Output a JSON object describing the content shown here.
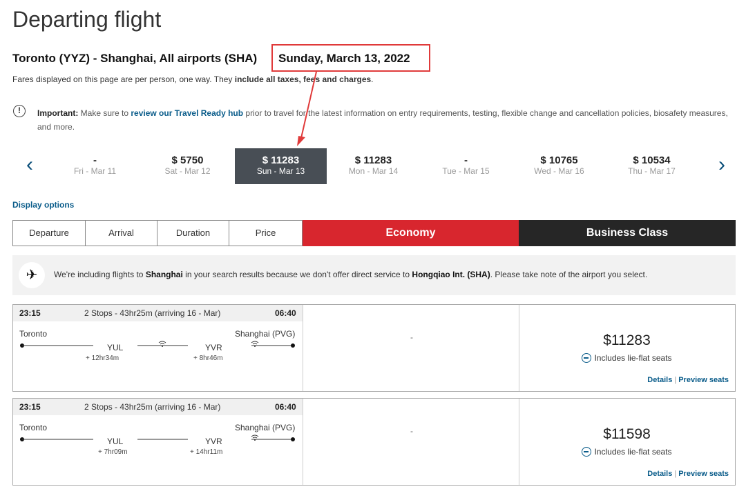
{
  "page_title": "Departing flight",
  "route": "Toronto (YYZ) - Shanghai, All airports (SHA)",
  "selected_date": "Sunday, March 13, 2022",
  "fares_note_prefix": "Fares displayed on this page are per person, one way. They ",
  "fares_note_bold": "include all taxes, fees and charges",
  "fares_note_suffix": ".",
  "important": {
    "label": "Important:",
    "text1": " Make sure to ",
    "link": "review our Travel Ready hub",
    "text2": " prior to travel for the latest information on entry requirements, testing, flexible change and cancellation policies, biosafety measures, and more."
  },
  "dates": [
    {
      "price": "-",
      "date": "Fri - Mar 11"
    },
    {
      "price": "$ 5750",
      "date": "Sat - Mar 12"
    },
    {
      "price": "$ 11283",
      "date": "Sun - Mar 13"
    },
    {
      "price": "$ 11283",
      "date": "Mon - Mar 14"
    },
    {
      "price": "-",
      "date": "Tue - Mar 15"
    },
    {
      "price": "$ 10765",
      "date": "Wed - Mar 16"
    },
    {
      "price": "$ 10534",
      "date": "Thu - Mar 17"
    }
  ],
  "display_options": "Display options",
  "sort": {
    "departure": "Departure",
    "arrival": "Arrival",
    "duration": "Duration",
    "price": "Price"
  },
  "cabins": {
    "economy": "Economy",
    "business": "Business Class"
  },
  "colors": {
    "economy": "#d8262e",
    "business": "#262626",
    "selected_date": "#484e55",
    "link": "#0a5c8a",
    "annotation": "#e03a3a"
  },
  "notice": {
    "t1": "We're including flights to ",
    "b1": "Shanghai",
    "t2": " in your search results because we don't offer direct service to ",
    "b2": "Hongqiao Int. (SHA)",
    "t3": ". Please take note of the airport you select."
  },
  "flights": [
    {
      "dep": "23:15",
      "stops": "2 Stops - 43hr25m (arriving 16 - Mar)",
      "arr": "06:40",
      "from": "Toronto",
      "to": "Shanghai (PVG)",
      "stop1": "YUL",
      "stop2": "YVR",
      "lay1": "+ 12hr34m",
      "lay2": "+ 8hr46m",
      "details": "Details",
      "preview": "Preview seats",
      "economy": "-",
      "price": "$11283",
      "seats": "Includes lie-flat seats"
    },
    {
      "dep": "23:15",
      "stops": "2 Stops - 43hr25m (arriving 16 - Mar)",
      "arr": "06:40",
      "from": "Toronto",
      "to": "Shanghai (PVG)",
      "stop1": "YUL",
      "stop2": "YVR",
      "lay1": "+ 7hr09m",
      "lay2": "+ 14hr11m",
      "details": "Details",
      "preview": "Preview seats",
      "economy": "-",
      "price": "$11598",
      "seats": "Includes lie-flat seats"
    }
  ]
}
